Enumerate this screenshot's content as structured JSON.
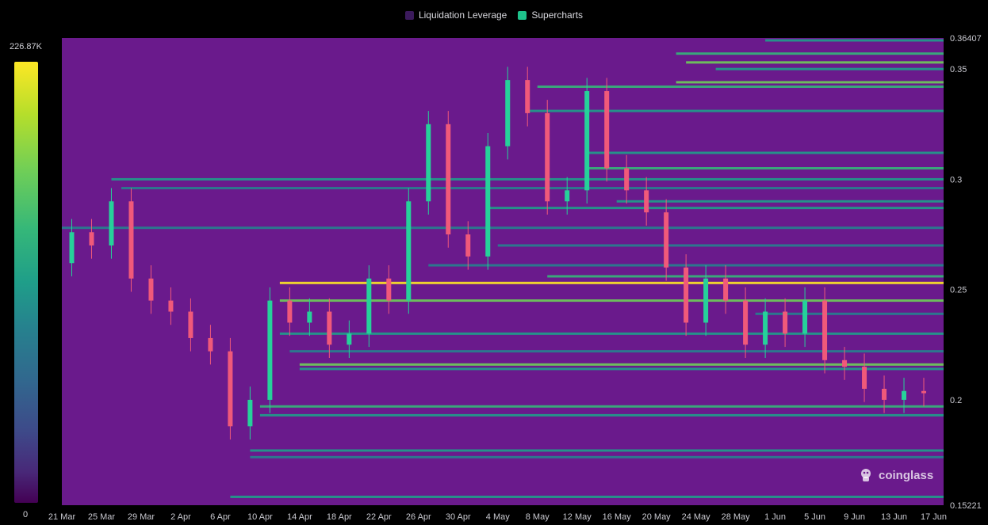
{
  "legend": {
    "items": [
      {
        "label": "Liquidation Leverage",
        "color": "#3b1a5c"
      },
      {
        "label": "Supercharts",
        "color": "#1ec28b"
      }
    ]
  },
  "colorbar": {
    "max_label": "226.87K",
    "min_label": "0"
  },
  "watermark": {
    "text": "coinglass",
    "icon": "coinglass-logo-icon"
  },
  "colors": {
    "background": "#6a1a8c",
    "up": "#26d19a",
    "down": "#f0597a",
    "hot": "#fde725"
  },
  "chart_data": {
    "type": "heatmap",
    "title": "",
    "xlabel": "",
    "ylabel": "",
    "x_tick_labels": [
      "21 Mar",
      "25 Mar",
      "29 Mar",
      "2 Apr",
      "6 Apr",
      "10 Apr",
      "14 Apr",
      "18 Apr",
      "22 Apr",
      "26 Apr",
      "30 Apr",
      "4 May",
      "8 May",
      "12 May",
      "16 May",
      "20 May",
      "24 May",
      "28 May",
      "1 Jun",
      "5 Jun",
      "9 Jun",
      "13 Jun",
      "17 Jun"
    ],
    "y_tick_labels": [
      "0.36407",
      "0.35",
      "0.3",
      "0.25",
      "0.2",
      "0.15221"
    ],
    "y_tick_values": [
      0.36407,
      0.35,
      0.3,
      0.25,
      0.2,
      0.15221
    ],
    "ylim": [
      0.15221,
      0.36407
    ],
    "y_axis_position": "right",
    "legend_position": "top-center",
    "price_series": {
      "name": "Supercharts",
      "date_index": [
        0,
        2,
        4,
        6,
        8,
        10,
        12,
        14,
        16,
        18,
        20,
        22,
        24,
        26,
        28,
        30,
        32,
        34,
        36,
        38,
        40,
        42,
        44,
        46,
        48,
        50,
        52,
        54,
        56,
        58,
        60,
        62,
        64,
        66,
        68,
        70,
        72,
        74,
        76,
        78,
        80,
        82,
        84,
        86,
        88
      ],
      "close": [
        0.262,
        0.276,
        0.27,
        0.29,
        0.255,
        0.245,
        0.24,
        0.228,
        0.222,
        0.188,
        0.2,
        0.245,
        0.235,
        0.24,
        0.225,
        0.23,
        0.255,
        0.245,
        0.29,
        0.325,
        0.275,
        0.265,
        0.315,
        0.345,
        0.33,
        0.29,
        0.295,
        0.34,
        0.305,
        0.295,
        0.285,
        0.26,
        0.235,
        0.255,
        0.245,
        0.225,
        0.24,
        0.23,
        0.245,
        0.218,
        0.215,
        0.205,
        0.2,
        0.204,
        0.203
      ]
    },
    "liquidation_levels": [
      {
        "price": 0.363,
        "start": 71,
        "intensity": 0.55
      },
      {
        "price": 0.357,
        "start": 62,
        "intensity": 0.65
      },
      {
        "price": 0.353,
        "start": 63,
        "intensity": 0.8
      },
      {
        "price": 0.35,
        "start": 66,
        "intensity": 0.55
      },
      {
        "price": 0.344,
        "start": 62,
        "intensity": 0.75
      },
      {
        "price": 0.342,
        "start": 48,
        "intensity": 0.6
      },
      {
        "price": 0.331,
        "start": 47,
        "intensity": 0.5
      },
      {
        "price": 0.312,
        "start": 53,
        "intensity": 0.55
      },
      {
        "price": 0.305,
        "start": 53,
        "intensity": 0.65
      },
      {
        "price": 0.3,
        "start": 5,
        "intensity": 0.45
      },
      {
        "price": 0.296,
        "start": 6,
        "intensity": 0.35
      },
      {
        "price": 0.29,
        "start": 56,
        "intensity": 0.45
      },
      {
        "price": 0.287,
        "start": 43,
        "intensity": 0.55
      },
      {
        "price": 0.278,
        "start": 0,
        "intensity": 0.4
      },
      {
        "price": 0.27,
        "start": 44,
        "intensity": 0.35
      },
      {
        "price": 0.261,
        "start": 37,
        "intensity": 0.35
      },
      {
        "price": 0.256,
        "start": 49,
        "intensity": 0.6
      },
      {
        "price": 0.253,
        "start": 22,
        "intensity": 0.95
      },
      {
        "price": 0.245,
        "start": 22,
        "intensity": 0.7
      },
      {
        "price": 0.239,
        "start": 70,
        "intensity": 0.4
      },
      {
        "price": 0.23,
        "start": 22,
        "intensity": 0.45
      },
      {
        "price": 0.222,
        "start": 23,
        "intensity": 0.4
      },
      {
        "price": 0.216,
        "start": 24,
        "intensity": 0.7
      },
      {
        "price": 0.214,
        "start": 24,
        "intensity": 0.55
      },
      {
        "price": 0.197,
        "start": 20,
        "intensity": 0.6
      },
      {
        "price": 0.193,
        "start": 20,
        "intensity": 0.45
      },
      {
        "price": 0.177,
        "start": 19,
        "intensity": 0.55
      },
      {
        "price": 0.174,
        "start": 19,
        "intensity": 0.4
      },
      {
        "price": 0.156,
        "start": 17,
        "intensity": 0.55
      }
    ]
  }
}
